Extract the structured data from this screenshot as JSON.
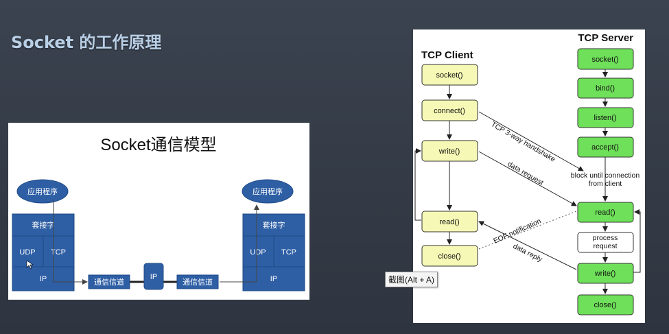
{
  "slide": {
    "title": "Socket 的工作原理"
  },
  "left_diagram": {
    "title": "Socket通信模型",
    "left_host": {
      "app": "应用程序",
      "socket": "套接字",
      "udp": "UDP",
      "tcp": "TCP",
      "ip": "IP"
    },
    "right_host": {
      "app": "应用程序",
      "socket": "套接字",
      "udp": "UDP",
      "tcp": "TCP",
      "ip": "IP"
    },
    "channel_left": "通信信道",
    "channel_right": "通信信道",
    "router_ip": "IP"
  },
  "right_diagram": {
    "client_title": "TCP Client",
    "server_title": "TCP Server",
    "client_steps": [
      "socket()",
      "connect()",
      "write()",
      "read()",
      "close()"
    ],
    "server_steps": [
      "socket()",
      "bind()",
      "listen()",
      "accept()",
      "read()",
      "process request",
      "write()",
      "close()"
    ],
    "block_text": [
      "block until connection",
      "from client"
    ],
    "labels": {
      "handshake": "TCP 3-way handshake",
      "data_request": "data request",
      "eof": "EOF notification",
      "data_reply": "data reply"
    },
    "colors": {
      "step_fill": "#f6f9b5",
      "server_fill": "#6fe05a",
      "process_fill": "#ffffff"
    }
  },
  "tooltip": {
    "text": "截图(Alt + A)"
  }
}
